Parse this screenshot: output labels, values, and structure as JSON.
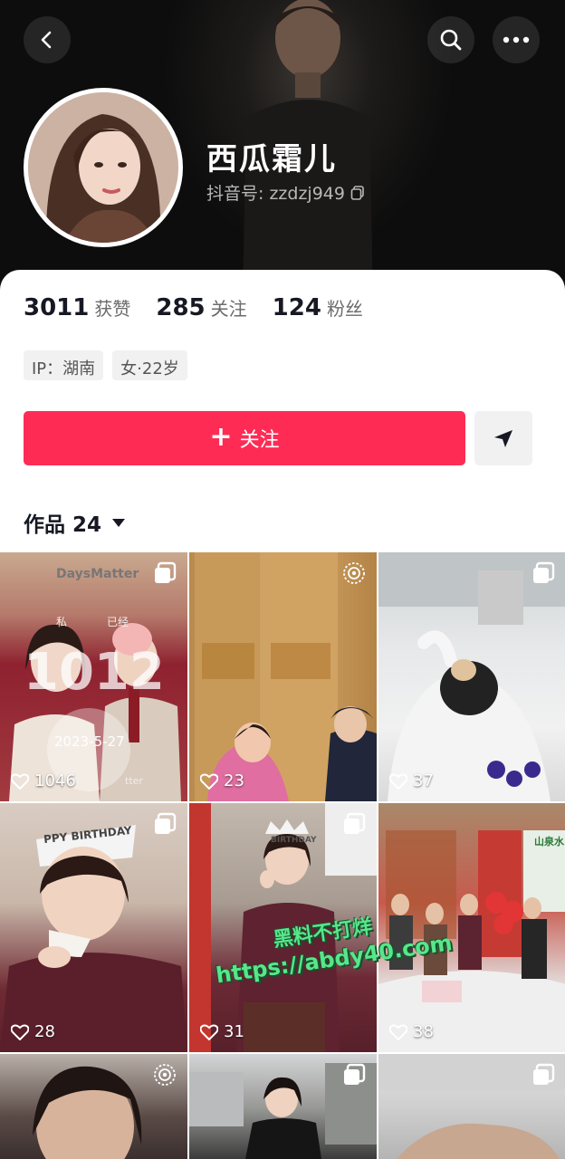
{
  "profile": {
    "nickname": "西瓜霜儿",
    "douyin_id_label": "抖音号: zzdzj949",
    "stats": [
      {
        "count": "3011",
        "label": "获赞"
      },
      {
        "count": "285",
        "label": "关注"
      },
      {
        "count": "124",
        "label": "粉丝"
      }
    ],
    "tags": [
      "IP：湖南",
      "女·22岁"
    ]
  },
  "actions": {
    "follow_label": "关注",
    "follow_icon": "plus-icon",
    "share_icon": "send-icon"
  },
  "works": {
    "label": "作品 24",
    "items": [
      {
        "likes": "1046",
        "badge": "album-icon",
        "overlay_texts": [
          "DaysMatter",
          "私",
          "已经",
          "1012",
          "2023-5-27",
          "tter"
        ]
      },
      {
        "likes": "23",
        "badge": "live-photo-icon"
      },
      {
        "likes": "37",
        "badge": "album-icon"
      },
      {
        "likes": "28",
        "badge": "album-icon",
        "overlay_texts": [
          "PPY BIRTHDAY"
        ]
      },
      {
        "likes": "31",
        "badge": "album-icon",
        "overlay_texts": [
          "BIRTHDAY"
        ]
      },
      {
        "likes": "38",
        "badge": "",
        "overlay_texts": [
          "山泉水"
        ]
      },
      {
        "likes": "",
        "badge": "live-photo-icon"
      },
      {
        "likes": "",
        "badge": "album-icon"
      },
      {
        "likes": "",
        "badge": "album-icon"
      }
    ]
  },
  "watermark": {
    "line1": "黑料不打烊",
    "line2": "https://abdy40.com"
  },
  "colors": {
    "accent": "#fe2c55",
    "header_bg": "#141414",
    "watermark": "#58e68a"
  }
}
